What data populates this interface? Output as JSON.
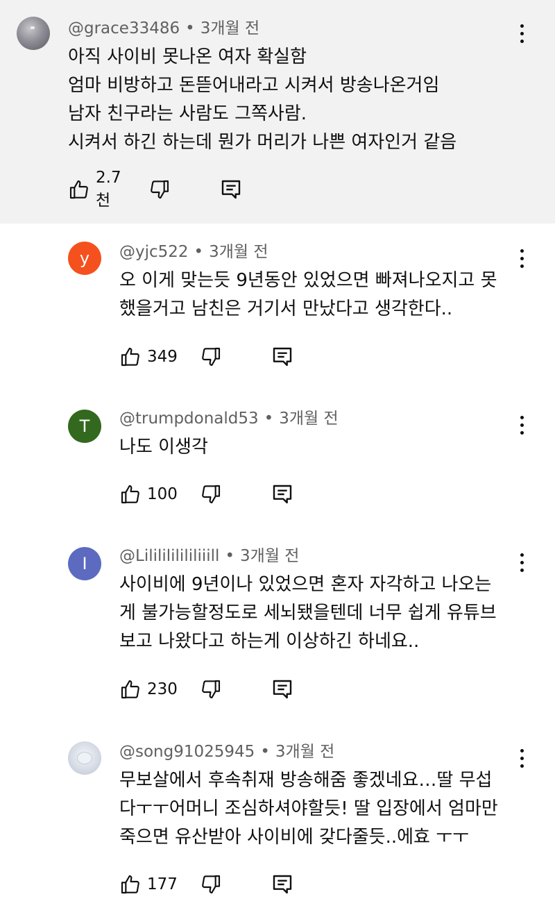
{
  "comments": [
    {
      "username": "@grace33486",
      "time": "3개월 전",
      "avatar_letter": "",
      "avatar_color": "#9a9aa2",
      "lines": [
        "아직 사이비 못나온 여자 확실함",
        "엄마 비방하고 돈뜯어내라고 시켜서 방송나온거임",
        "남자 친구라는 사람도 그쪽사람.",
        "시켜서 하긴 하는데 뭔가 머리가 나쁜 여자인거 같음"
      ],
      "likes": "2.7천"
    },
    {
      "username": "@yjc522",
      "time": "3개월 전",
      "avatar_letter": "y",
      "avatar_color": "#f4511e",
      "lines": [
        "오 이게 맞는듯 9년동안 있었으면 빠져나오지고 못",
        "했을거고 남친은 거기서 만났다고 생각한다.."
      ],
      "likes": "349"
    },
    {
      "username": "@trumpdonald53",
      "time": "3개월 전",
      "avatar_letter": "T",
      "avatar_color": "#33691e",
      "lines": [
        "나도  이생각"
      ],
      "likes": "100"
    },
    {
      "username": "@Lililililililiiill",
      "time": "3개월 전",
      "avatar_letter": "I",
      "avatar_color": "#5c6bc0",
      "lines": [
        "사이비에 9년이나 있었으면 혼자 자각하고 나오는",
        "게 불가능할정도로 세뇌됐을텐데 너무 쉽게 유튜브",
        "보고 나왔다고 하는게 이상하긴 하네요.."
      ],
      "likes": "230"
    },
    {
      "username": "@song91025945",
      "time": "3개월 전",
      "avatar_letter": "",
      "avatar_color": "#cfd6e0",
      "lines": [
        "무보살에서 후속취재 방송해줌 좋겠네요…딸 무섭",
        "다ㅜㅜ어머니 조심하셔야할듯! 딸 입장에서 엄마만",
        "죽으면 유산받아 사이비에 갖다줄듯..에효 ㅜㅜ"
      ],
      "likes": "177"
    }
  ],
  "icons": {
    "like": "thumbs-up-icon",
    "dislike": "thumbs-down-icon",
    "reply": "reply-icon",
    "more": "more-vert-icon"
  }
}
